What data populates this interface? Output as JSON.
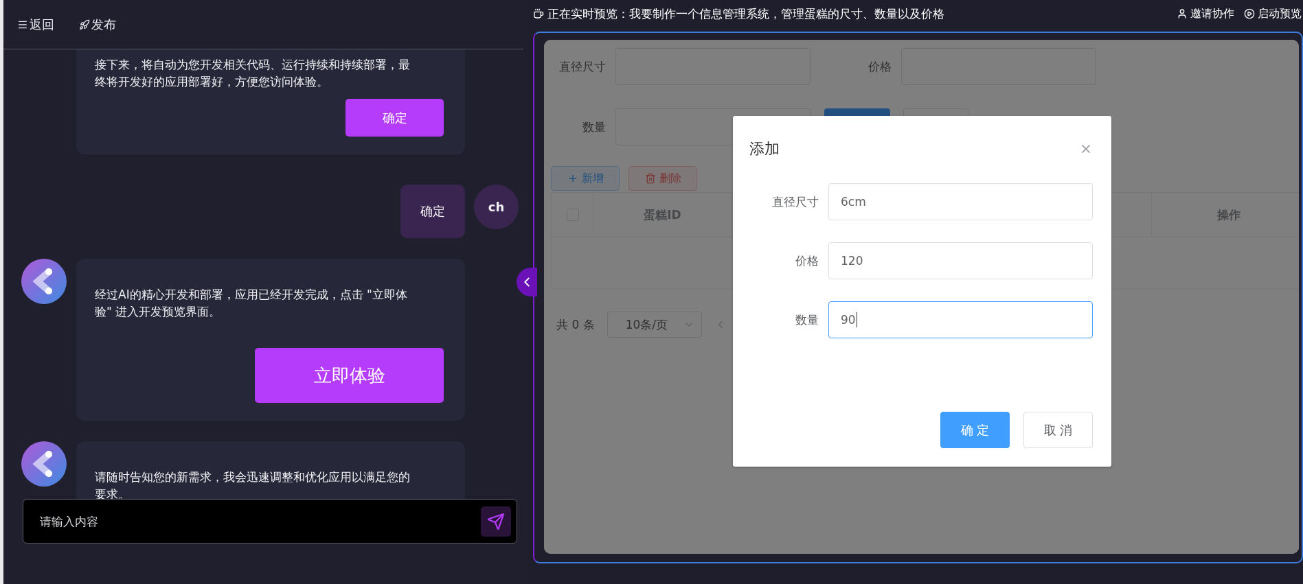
{
  "left_panel": {
    "header": [
      {
        "kind": "back",
        "label": "返回"
      },
      {
        "kind": "publish",
        "label": "发布"
      }
    ],
    "messages": [
      {
        "kind": "bot",
        "avatar": false,
        "text": "接下来，将自动为您开发相关代码、运行持续和持续部署，最终将开发好的应用部署好，方便您访问体验。",
        "button": {
          "kind": "confirm",
          "label": "确定"
        }
      },
      {
        "kind": "user",
        "text": "确定",
        "avatar": "ch"
      },
      {
        "kind": "bot",
        "avatar": true,
        "text": "经过AI的精心开发和部署，应用已经开发完成，点击 \"立即体验\" 进入开发预览界面。",
        "button": {
          "kind": "try",
          "label": "立即体验"
        }
      },
      {
        "kind": "bot",
        "avatar": true,
        "text": "请随时告知您的新需求，我会迅速调整和优化应用以满足您的要求。"
      }
    ],
    "input": {
      "placeholder": "请输入内容"
    }
  },
  "preview": {
    "title": "正在实时预览：我要制作一个信息管理系统，管理蛋糕的尺寸、数量以及价格",
    "actions": [
      {
        "kind": "invite",
        "label": "邀请协作"
      },
      {
        "kind": "start",
        "label": "启动预览"
      }
    ],
    "filters": [
      {
        "label": "直径尺寸"
      },
      {
        "label": "价格"
      },
      {
        "label": "数量"
      }
    ],
    "toolbar": [
      {
        "kind": "add",
        "label": "新增"
      },
      {
        "kind": "delete",
        "label": "删除"
      }
    ],
    "table": {
      "select_all": {
        "checked": false
      },
      "columns": [
        "蛋糕ID",
        "操作"
      ]
    },
    "pagination": {
      "total": "共 0 条",
      "page_size": "10条/页"
    },
    "dialog": {
      "title": "添加",
      "fields": [
        {
          "label": "直径尺寸",
          "value": "6cm",
          "focused": false
        },
        {
          "label": "价格",
          "value": "120",
          "focused": false
        },
        {
          "label": "数量",
          "value": "90",
          "focused": true
        }
      ],
      "buttons": [
        {
          "kind": "primary",
          "label": "确定"
        },
        {
          "kind": "default",
          "label": "取消"
        }
      ]
    }
  }
}
